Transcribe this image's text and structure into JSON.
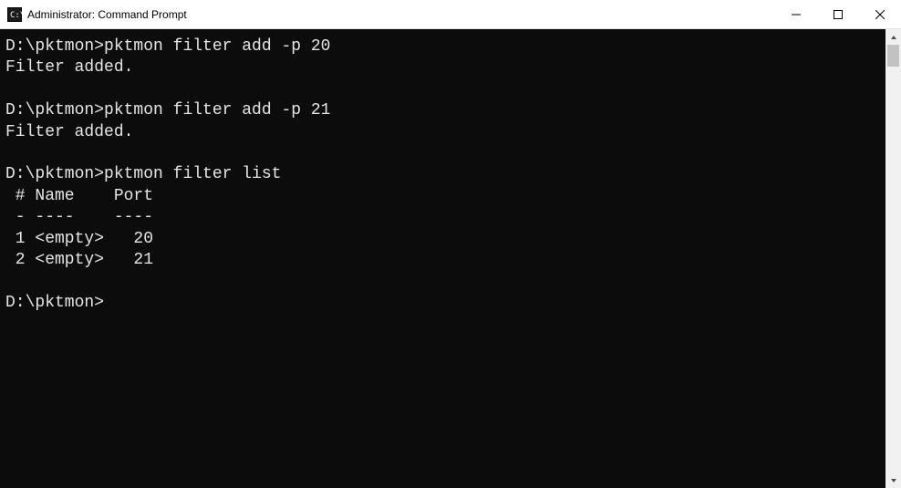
{
  "window": {
    "title": "Administrator: Command Prompt"
  },
  "terminal": {
    "lines": [
      {
        "prompt": "D:\\pktmon>",
        "cmd": "pktmon filter add -p 20"
      },
      {
        "text": "Filter added."
      },
      {
        "text": ""
      },
      {
        "prompt": "D:\\pktmon>",
        "cmd": "pktmon filter add -p 21"
      },
      {
        "text": "Filter added."
      },
      {
        "text": ""
      },
      {
        "prompt": "D:\\pktmon>",
        "cmd": "pktmon filter list"
      },
      {
        "text": " # Name    Port"
      },
      {
        "text": " - ----    ----"
      },
      {
        "text": " 1 <empty>   20"
      },
      {
        "text": " 2 <empty>   21"
      },
      {
        "text": ""
      },
      {
        "prompt": "D:\\pktmon>",
        "cmd": ""
      }
    ]
  }
}
